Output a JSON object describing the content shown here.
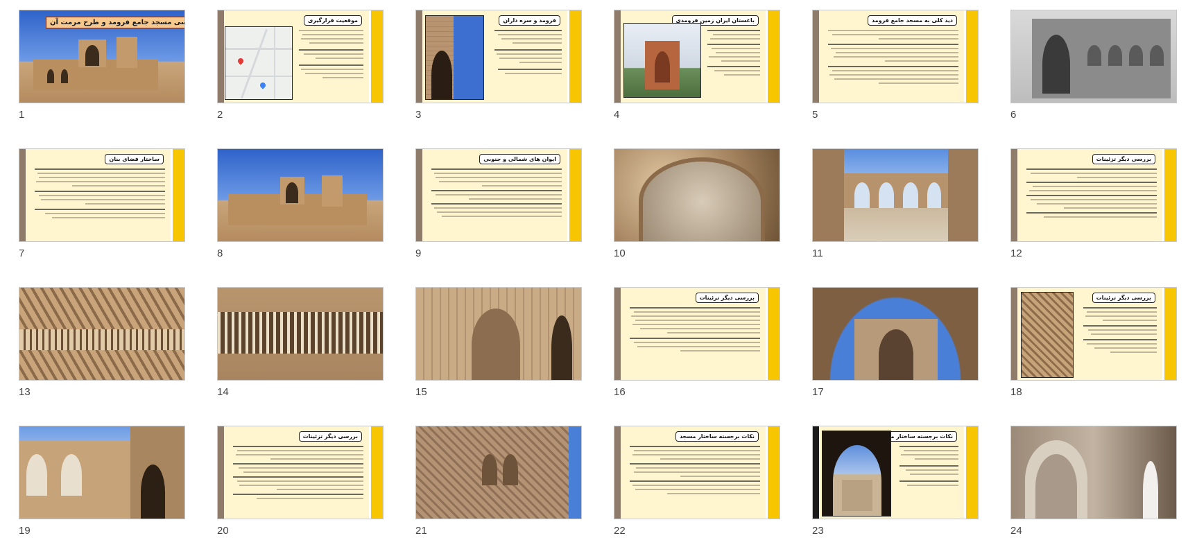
{
  "slides": [
    {
      "number": "1",
      "kind": "title",
      "title": "بررسی مسجد جامع فرومد و طرح مرمت آن"
    },
    {
      "number": "2",
      "kind": "text-map",
      "title": "موقعیت قرارگیری"
    },
    {
      "number": "3",
      "kind": "text-pic",
      "title": "فرومد و سره داران"
    },
    {
      "number": "4",
      "kind": "text-pic",
      "title": "باغستان ایران زمین فرومدی"
    },
    {
      "number": "5",
      "kind": "text",
      "title": "دید کلی به مسجد جامع فرومد"
    },
    {
      "number": "6",
      "kind": "photo"
    },
    {
      "number": "7",
      "kind": "text",
      "title": "ساختار فضای بنان"
    },
    {
      "number": "8",
      "kind": "photo"
    },
    {
      "number": "9",
      "kind": "text",
      "title": "ایوان های شمالی و جنوبی"
    },
    {
      "number": "10",
      "kind": "photo"
    },
    {
      "number": "11",
      "kind": "photo"
    },
    {
      "number": "12",
      "kind": "text",
      "title": "بررسی دیگر تزئینات"
    },
    {
      "number": "13",
      "kind": "photo"
    },
    {
      "number": "14",
      "kind": "photo"
    },
    {
      "number": "15",
      "kind": "photo"
    },
    {
      "number": "16",
      "kind": "text",
      "title": "بررسی دیگر تزئینات"
    },
    {
      "number": "17",
      "kind": "photo"
    },
    {
      "number": "18",
      "kind": "text-pic",
      "title": "بررسی دیگر تزئینات"
    },
    {
      "number": "19",
      "kind": "photo"
    },
    {
      "number": "20",
      "kind": "text",
      "title": "بررسی دیگر تزئینات"
    },
    {
      "number": "21",
      "kind": "photo"
    },
    {
      "number": "22",
      "kind": "text",
      "title": "نکات برجسته ساختار مسجد"
    },
    {
      "number": "23",
      "kind": "text-pic",
      "title": "نکات برجسته ساختار مسجد"
    },
    {
      "number": "24",
      "kind": "photo"
    }
  ]
}
